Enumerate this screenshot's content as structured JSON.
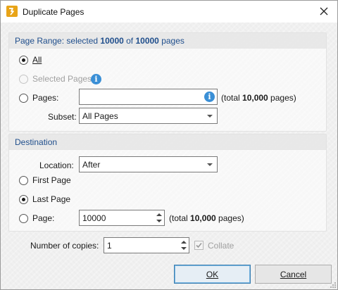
{
  "window": {
    "title": "Duplicate Pages",
    "icon": "pdf-editor-app-icon"
  },
  "page_range": {
    "title_prefix": "Page Range: selected ",
    "selected": "10000",
    "title_mid": " of ",
    "total": "10000",
    "title_suffix": " pages",
    "options": {
      "all": {
        "label": "All",
        "checked": true
      },
      "selected_pages": {
        "label": "Selected Pages",
        "enabled": false
      },
      "pages": {
        "label": "Pages:",
        "value": "",
        "info_icon": "info-icon"
      }
    },
    "total_note_prefix": "(total ",
    "total_note_value": "10,000",
    "total_note_suffix": " pages)",
    "subset": {
      "label": "Subset:",
      "value": "All Pages"
    }
  },
  "destination": {
    "title": "Destination",
    "location": {
      "label": "Location:",
      "value": "After"
    },
    "options": {
      "first_page": {
        "label": "First Page",
        "checked": false
      },
      "last_page": {
        "label": "Last Page",
        "checked": true
      },
      "page": {
        "label": "Page:",
        "value": "10000",
        "checked": false
      }
    },
    "total_note_prefix": "(total ",
    "total_note_value": "10,000",
    "total_note_suffix": " pages)"
  },
  "copies": {
    "label": "Number of copies:",
    "value": "1",
    "collate": {
      "label": "Collate",
      "checked": true,
      "enabled": false
    }
  },
  "buttons": {
    "ok": "OK",
    "cancel": "Cancel"
  }
}
